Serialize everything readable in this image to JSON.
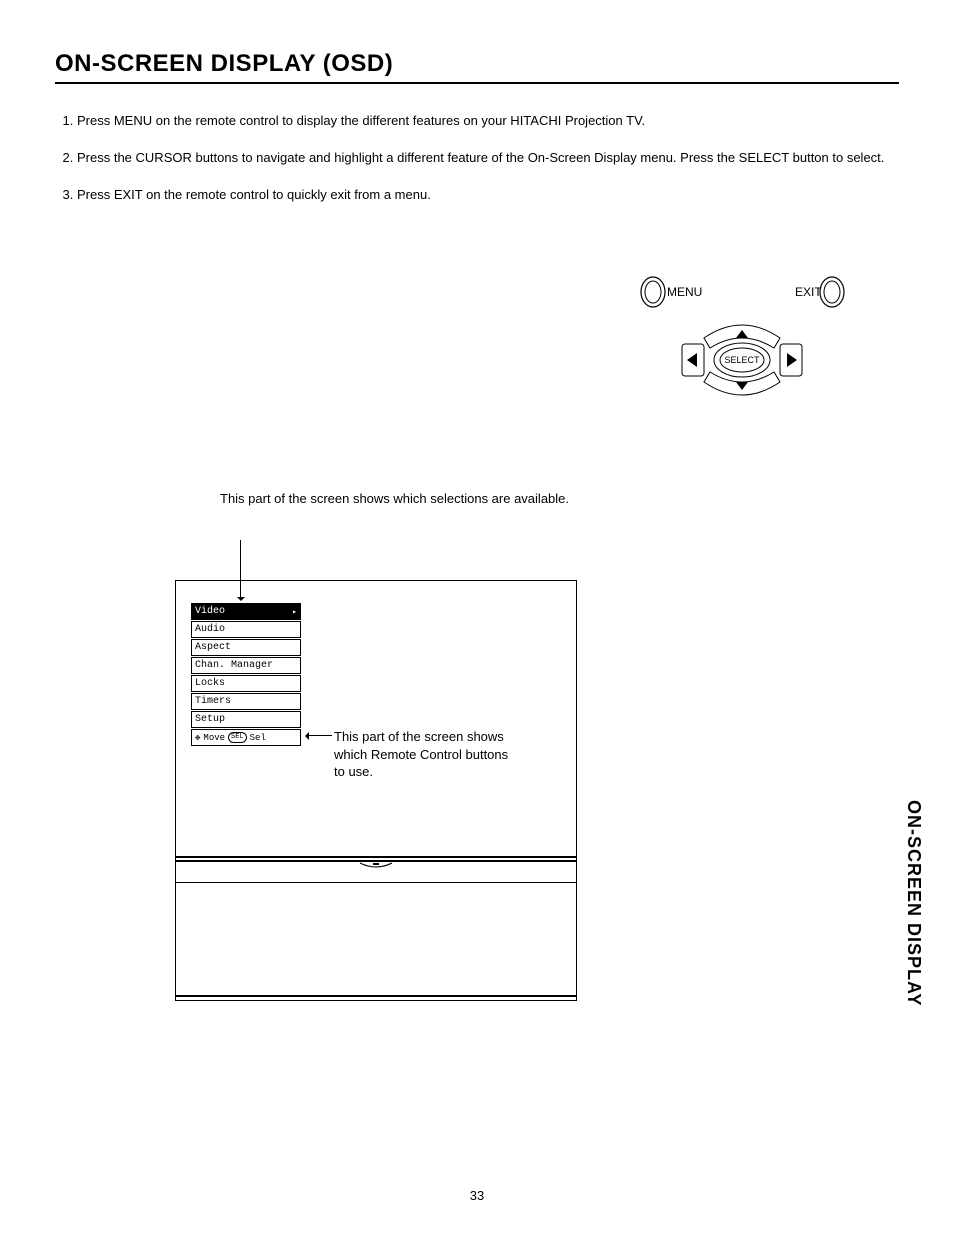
{
  "title": "ON-SCREEN DISPLAY (OSD)",
  "steps": {
    "s1": "Press MENU on the remote control to display the different features on your HITACHI Projection TV.",
    "s2": "Press the CURSOR buttons to navigate and highlight a different feature of the On-Screen Display menu. Press the SELECT button to select.",
    "s3": "Press EXIT on the remote control to quickly exit from a menu."
  },
  "remote": {
    "menu": "MENU",
    "exit": "EXIT",
    "select": "SELECT"
  },
  "captions": {
    "top": "This part of the screen shows which selections are available.",
    "side": "This part of the screen shows which Remote Control buttons to use."
  },
  "menu": {
    "items": [
      "Video",
      "Audio",
      "Aspect",
      "Chan. Manager",
      "Locks",
      "Timers",
      "Setup"
    ],
    "hint_move": "Move",
    "hint_sel_box": "SEL",
    "hint_sel": "Sel"
  },
  "page_number": "33",
  "side_tab": "ON-SCREEN DISPLAY"
}
